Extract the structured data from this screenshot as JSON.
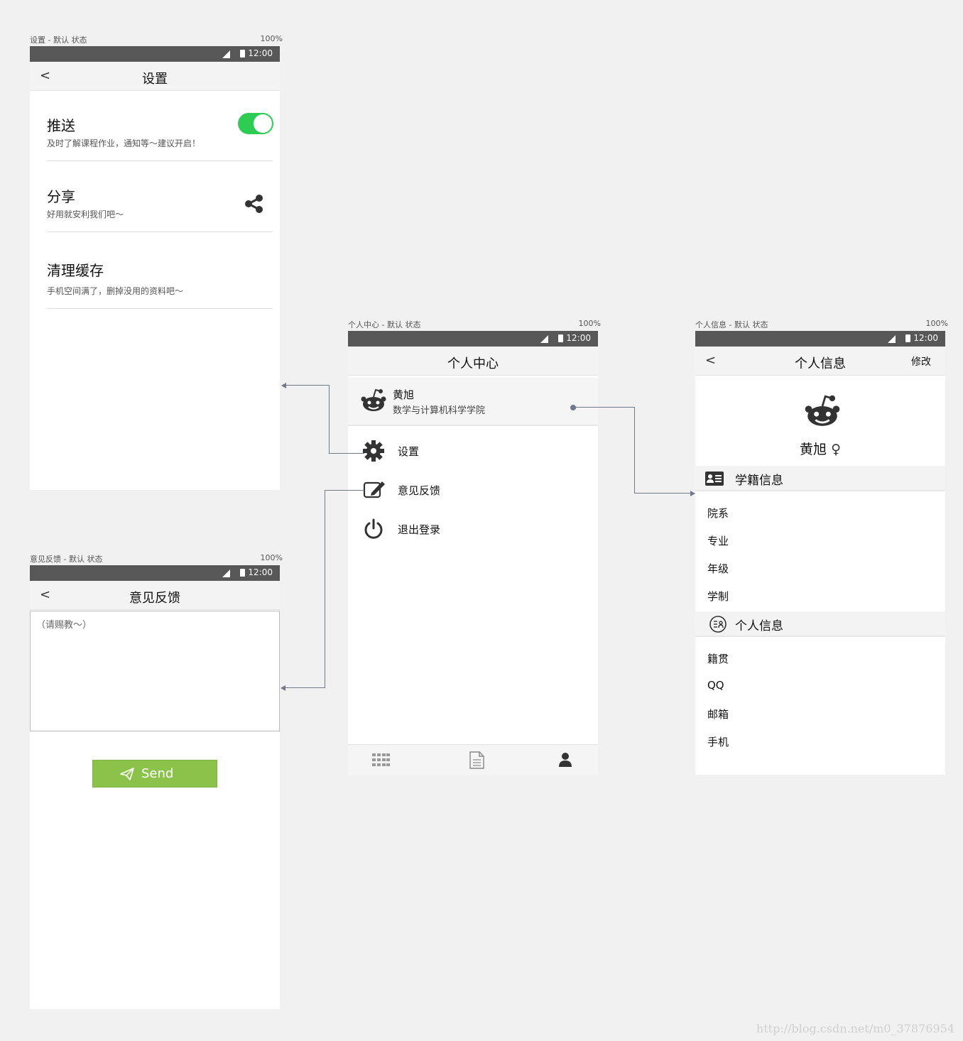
{
  "settings": {
    "caption": "设置 - 默认 状态",
    "percent": "100%",
    "time": "12:00",
    "back": "<",
    "title": "设置",
    "rows": [
      {
        "title": "推送",
        "subtitle": "及时了解课程作业，通知等～建议开启！",
        "toggle_on": true
      },
      {
        "title": "分享",
        "subtitle": "好用就安利我们吧～",
        "icon": "share-icon"
      },
      {
        "title": "清理缓存",
        "subtitle": "手机空间满了，删掉没用的资料吧～"
      }
    ]
  },
  "feedback": {
    "caption": "意见反馈 - 默认 状态",
    "percent": "100%",
    "time": "12:00",
    "back": "<",
    "title": "意见反馈",
    "placeholder": "（请赐教～）",
    "send_label": "Send",
    "send_color": "#8bc34a"
  },
  "center": {
    "caption": "个人中心 - 默认 状态",
    "percent": "100%",
    "time": "12:00",
    "title": "个人中心",
    "user": {
      "name": "黄旭",
      "college": "数学与计算机科学学院"
    },
    "menu": [
      {
        "label": "设置",
        "icon": "gear-icon"
      },
      {
        "label": "意见反馈",
        "icon": "edit-icon"
      },
      {
        "label": "退出登录",
        "icon": "power-icon"
      }
    ],
    "tabbar": [
      "grid-icon",
      "document-icon",
      "user-icon"
    ]
  },
  "info": {
    "caption": "个人信息 - 默认 状态",
    "percent": "100%",
    "time": "12:00",
    "back": "<",
    "title": "个人信息",
    "edit": "修改",
    "name": "黄旭",
    "gender_symbol": "♀",
    "section1": {
      "label": "学籍信息",
      "fields": [
        "院系",
        "专业",
        "年级",
        "学制"
      ]
    },
    "section2": {
      "label": "个人信息",
      "fields": [
        "籍贯",
        "QQ",
        "邮箱",
        "手机"
      ]
    }
  },
  "watermark": "http://blog.csdn.net/m0_37876954"
}
